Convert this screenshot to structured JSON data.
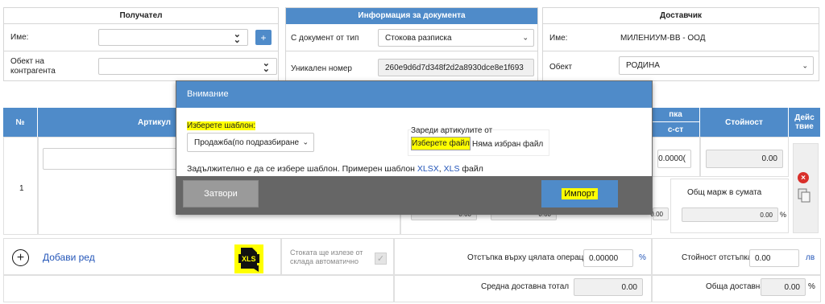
{
  "recipient": {
    "title": "Получател",
    "name_label": "Име:",
    "name_value": "",
    "object_label": "Обект на контрагента",
    "object_value": "",
    "add_button": "+"
  },
  "doc_info": {
    "title": "Информация за документа",
    "doc_type_label": "С документ от тип",
    "doc_type_value": "Стокова разписка",
    "unique_label": "Уникален номер",
    "unique_value": "260e9d6d7d348f2d2a8930dce8e1f693"
  },
  "supplier": {
    "title": "Доставчик",
    "name_label": "Име:",
    "name_value": "МИЛЕНИУМ-ВВ - ООД",
    "object_label": "Обект",
    "object_value": "РОДИНА"
  },
  "table": {
    "col_no": "№",
    "col_article": "Артикул",
    "col_discount_top": "пка",
    "col_discount_sub": "с-ст",
    "col_value": "Стойност",
    "col_actions": "Дейс твие",
    "row_no": "1",
    "row_discount": "0.0000(",
    "row_value": "0.00",
    "margin_label": "Общ марж в сумата",
    "margin_value": "0.00",
    "margin_unit": "%",
    "small_a": "0.00",
    "small_b": "0.00",
    "small_c": "0.00"
  },
  "footer": {
    "add_row": "Добави ред",
    "xls_label": "XLS",
    "auto_out_label": "Стоката ще излезе от склада автоматично",
    "discount_op_label": "Отстъпка върху цялата операция",
    "discount_op_value": "0.00000",
    "discount_op_unit": "%",
    "discount_value_label": "Стойност отстъпка",
    "discount_value_value": "0.00",
    "discount_value_unit": "лв",
    "avg_label": "Средна доставна тотал",
    "avg_value": "0.00",
    "total_label": "Обща доставна",
    "total_value": "0.00",
    "total_unit": "%"
  },
  "modal": {
    "title": "Внимание",
    "template_label": "Изберете шаблон:",
    "template_value": "Продажба(по подразбиране",
    "load_label": "Зареди артикулите от",
    "choose_file": "Изберете файл",
    "no_file": "Няма избран файл",
    "note_prefix": "Задължително е да се избере шаблон. Примерен шаблон ",
    "note_xlsx": "XLSX",
    "note_comma": ", ",
    "note_xls": "XLS",
    "note_suffix": " файл",
    "close_button": "Затвори",
    "import_button": "Импорт"
  }
}
